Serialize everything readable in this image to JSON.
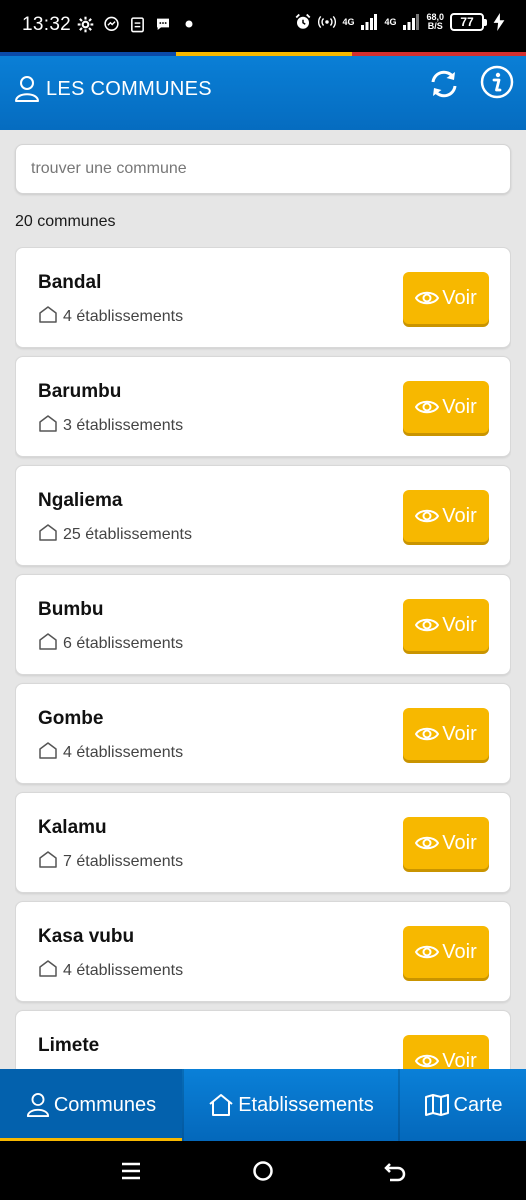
{
  "status_bar": {
    "time": "13:32",
    "net_1": "4G",
    "net_2": "4G",
    "speed_value": "68,0",
    "speed_unit": "B/S",
    "battery": "77"
  },
  "flag_colors": [
    "#0b4aa8",
    "#f7b800",
    "#d32f2f"
  ],
  "app_bar": {
    "title": "LES COMMUNES"
  },
  "search": {
    "placeholder": "trouver une commune",
    "value": ""
  },
  "count_label": "20 communes",
  "communes": [
    {
      "name": "Bandal",
      "establishments": "4 établissements",
      "button": "Voir"
    },
    {
      "name": "Barumbu",
      "establishments": "3 établissements",
      "button": "Voir"
    },
    {
      "name": "Ngaliema",
      "establishments": "25 établissements",
      "button": "Voir"
    },
    {
      "name": "Bumbu",
      "establishments": "6 établissements",
      "button": "Voir"
    },
    {
      "name": "Gombe",
      "establishments": "4 établissements",
      "button": "Voir"
    },
    {
      "name": "Kalamu",
      "establishments": "7 établissements",
      "button": "Voir"
    },
    {
      "name": "Kasa vubu",
      "establishments": "4 établissements",
      "button": "Voir"
    },
    {
      "name": "Limete",
      "establishments": "",
      "button": "Voir"
    }
  ],
  "bottom_nav": {
    "tabs": [
      {
        "label": "Communes",
        "icon": "user-icon",
        "active": true
      },
      {
        "label": "Etablissements",
        "icon": "home-icon",
        "active": false
      },
      {
        "label": "Carte",
        "icon": "map-icon",
        "active": false
      }
    ]
  },
  "colors": {
    "primary": "#0a7fd6",
    "accent": "#f7b800",
    "background": "#e6e6e6"
  }
}
